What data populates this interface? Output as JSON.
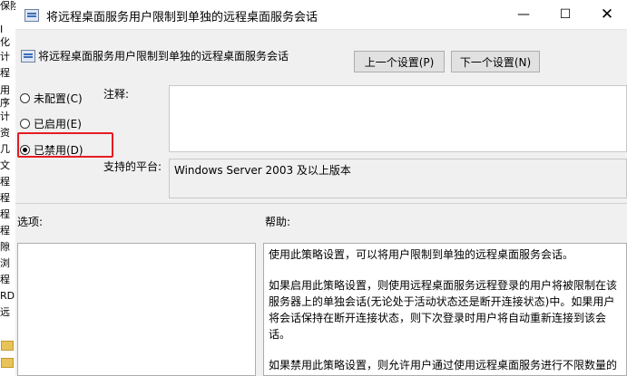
{
  "background_window": {
    "fragments": [
      "保险箱",
      "I",
      "化",
      "计",
      "程",
      "用",
      "序",
      "计",
      "资",
      "几",
      "文",
      "程",
      "程",
      "程",
      "程",
      "隙",
      "浏",
      "程",
      "RD",
      "远"
    ]
  },
  "dialog": {
    "title": "将远程桌面服务用户限制到单独的远程桌面服务会话",
    "controls": {
      "minimize": "—",
      "maximize": "☐",
      "close": "✕"
    },
    "setting_name": "将远程桌面服务用户限制到单独的远程桌面服务会话",
    "prev_button": "上一个设置(P)",
    "next_button": "下一个设置(N)",
    "radios": [
      {
        "label": "未配置(C)",
        "checked": false
      },
      {
        "label": "已启用(E)",
        "checked": false
      },
      {
        "label": "已禁用(D)",
        "checked": true
      }
    ],
    "comment_label": "注释:",
    "comment_value": "",
    "platform_label": "支持的平台:",
    "platform_value": "Windows Server 2003 及以上版本",
    "options_label": "选项:",
    "help_label": "帮助:",
    "help_paragraphs": [
      "使用此策略设置，可以将用户限制到单独的远程桌面服务会话。",
      "如果启用此策略设置，则使用远程桌面服务远程登录的用户将被限制在该服务器上的单独会话(无论处于活动状态还是断开连接状态)中。如果用户将会话保持在断开连接状态，则下次登录时用户将自动重新连接到该会话。",
      "如果禁用此策略设置，则允许用户通过使用远程桌面服务进行不限数量的同时远程连接。"
    ]
  },
  "colors": {
    "highlight_border": "#e81b23",
    "dialog_bg": "#f0f0f0"
  }
}
